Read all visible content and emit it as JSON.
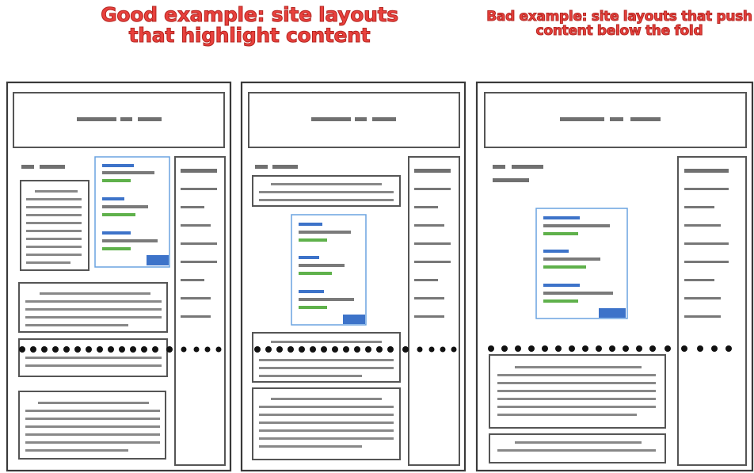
{
  "headings": {
    "good": "Good example: site layouts that highlight content",
    "bad": "Bad example: site layouts that push content below the fold"
  },
  "colors": {
    "heading": "#e8413d",
    "frame": "#3a3a3a",
    "placeholder_text": "#707070",
    "highlight_border": "#6aa3e0",
    "highlight_blue": "#3d73c9",
    "highlight_green": "#5fb14b",
    "fold_dots": "#111111"
  },
  "panels": [
    {
      "name": "layout-good-1",
      "highlight": "good"
    },
    {
      "name": "layout-good-2",
      "highlight": "good"
    },
    {
      "name": "layout-bad-1",
      "highlight": "bad"
    }
  ],
  "icons": [
    "fold-line-dots",
    "cta-button-icon"
  ]
}
